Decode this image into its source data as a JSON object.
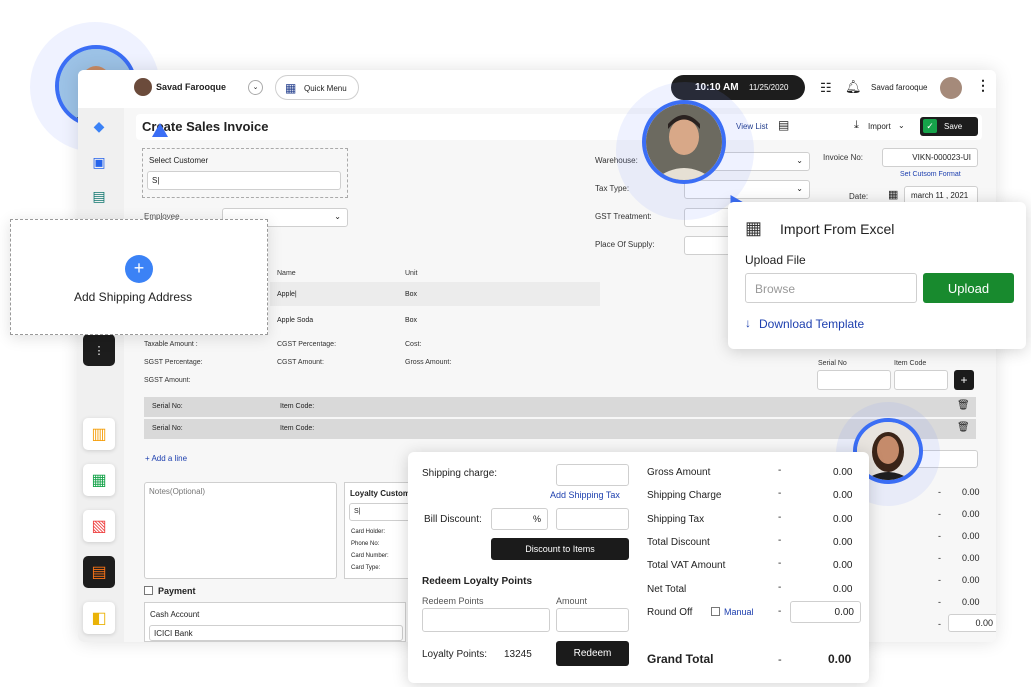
{
  "topbar": {
    "user_name": "Savad Farooque",
    "quick_menu": "Quick Menu",
    "time": "10:10 AM",
    "date": "11/25/2020",
    "right_user": "Savad farooque"
  },
  "header": {
    "title": "Create Sales Invoice",
    "view_list": "View List",
    "import": "Import",
    "save": "Save"
  },
  "form": {
    "select_customer_label": "Select Customer",
    "customer_value": "S|",
    "employee_label": "Employee",
    "warehouse_label": "Warehouse:",
    "tax_type_label": "Tax Type:",
    "gst_treatment_label": "GST Treatment:",
    "place_of_supply_label": "Place Of Supply:",
    "invoice_no_label": "Invoice No:",
    "invoice_no_value": "VIKN-000023-UI",
    "custom_format": "Set Cutsom Format",
    "date_label": "Date:",
    "date_value": "march 11 , 2021"
  },
  "table": {
    "col_name": "Name",
    "col_unit": "Unit",
    "row1_name": "Apple|",
    "row1_unit": "Box",
    "row2_name": "Apple Soda",
    "row2_unit": "Box",
    "taxable_amount": "Taxable Amount :",
    "cgst_percentage": "CGST Percentage:",
    "cost": "Cost:",
    "sgst_percentage": "SGST Percentage:",
    "cgst_amount": "CGST Amount:",
    "gross_amount": "Gross Amount:",
    "sgst_amount": "SGST Amount:",
    "serial_no_label": "Serial No",
    "item_code_label": "Item Code",
    "serial_row_label": "Serial No:",
    "item_code_row_label": "Item Code:",
    "add_line": "+ Add a line"
  },
  "notes": {
    "placeholder": "Notes(Optional)",
    "loyalty_customer": "Loyalty Customer",
    "loyalty_input": "S|",
    "card_holder": "Card Holder:",
    "phone_no": "Phone No:",
    "card_number": "Card Number:",
    "card_type": "Card Type:"
  },
  "payment": {
    "label": "Payment",
    "cash_account": "Cash Account",
    "bank": "ICICI Bank"
  },
  "shipping_address": {
    "label": "Add Shipping Address"
  },
  "import_excel": {
    "title": "Import From Excel",
    "upload_file": "Upload File",
    "browse": "Browse",
    "upload": "Upload",
    "download_template": "Download Template"
  },
  "summary": {
    "shipping_charge": "Shipping charge:",
    "add_shipping_tax": "Add Shipping Tax",
    "bill_discount": "Bill Discount:",
    "percent": "%",
    "discount_to_items": "Discount to Items",
    "redeem_title": "Redeem Loyalty Points",
    "redeem_points": "Redeem Points",
    "amount": "Amount",
    "loyalty_points_label": "Loyalty Points:",
    "loyalty_points_value": "13245",
    "redeem": "Redeem",
    "rows": [
      {
        "label": "Gross Amount",
        "dash": "-",
        "value": "0.00"
      },
      {
        "label": "Shipping Charge",
        "dash": "-",
        "value": "0.00"
      },
      {
        "label": "Shipping Tax",
        "dash": "-",
        "value": "0.00"
      },
      {
        "label": "Total Discount",
        "dash": "-",
        "value": "0.00"
      },
      {
        "label": "Total VAT Amount",
        "dash": "-",
        "value": "0.00"
      },
      {
        "label": "Net Total",
        "dash": "-",
        "value": "0.00"
      }
    ],
    "round_off": "Round Off",
    "manual": "Manual",
    "round_off_value": "0.00",
    "grand_total": "Grand Total",
    "grand_total_dash": "-",
    "grand_total_value": "0.00",
    "back_values": [
      "0.00",
      "0.00",
      "0.00",
      "0.00",
      "0.00",
      "0.00",
      "0.00"
    ],
    "back_dash": "-"
  }
}
